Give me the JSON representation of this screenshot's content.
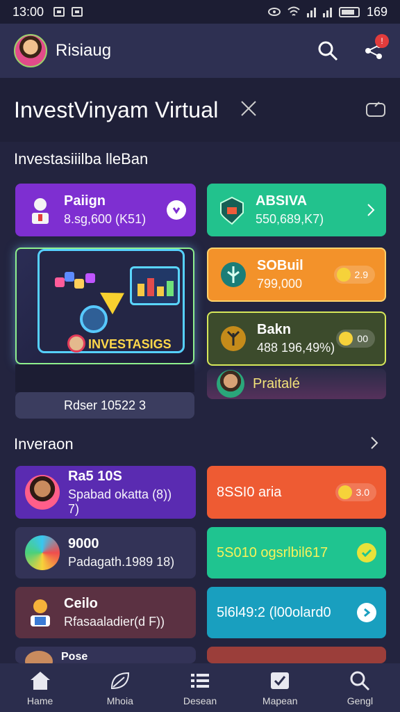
{
  "status_bar": {
    "time": "13:00",
    "battery": "169"
  },
  "header": {
    "app_name": "Risiaug",
    "notification_count": "!"
  },
  "title_bar": {
    "title": "InvestVinyam Virtual"
  },
  "section1": {
    "title": "Investasiiilba lleBan",
    "cards": [
      {
        "title": "Paiign",
        "subtitle": "8.sg,600 (K51)",
        "color": "#7e2fd1"
      },
      {
        "title": "ABSIVA",
        "subtitle": "550,689,K7)",
        "color": "#22c28d"
      },
      {
        "title": "SOBuil",
        "subtitle": "799,000",
        "pill": "2.9",
        "color": "#f3922a"
      },
      {
        "title": "Bakn",
        "subtitle": "488 196,49%)",
        "pill": "00",
        "color": "#3c4b2c"
      },
      {
        "title": "Praitalé",
        "color": "#55315b"
      }
    ],
    "promo": {
      "label": "INVESTASIGS",
      "footer": "Rdser 10522 3"
    }
  },
  "section2": {
    "title": "Inveraon",
    "left_cards": [
      {
        "title": "Ra5 10S",
        "subtitle": "Spabad okatta (8)) 7)",
        "color": "#5a2bb1"
      },
      {
        "title": "9000",
        "subtitle": "Padagath.1989 18)",
        "color": "#333357"
      },
      {
        "title": "Ceilo",
        "subtitle": "Rfasaaladier(d F))",
        "color": "#5b3142"
      },
      {
        "title": "Pose",
        "color": "#333357"
      }
    ],
    "right_cards": [
      {
        "title": "8SSI0 aria",
        "pill": "3.0",
        "color": "#ee5b33"
      },
      {
        "title": "5S010 ogsrlbil617",
        "color": "#1fc490"
      },
      {
        "title": "5l6l49:2 (l00olard0",
        "color": "#199fbf"
      },
      {
        "title": "",
        "color": "#9b3e3a"
      }
    ]
  },
  "bottom_nav": [
    {
      "label": "Hame",
      "icon": "home-icon"
    },
    {
      "label": "Mhoia",
      "icon": "leaf-icon"
    },
    {
      "label": "Desean",
      "icon": "list-icon"
    },
    {
      "label": "Mapean",
      "icon": "check-icon"
    },
    {
      "label": "Gengl",
      "icon": "search-icon"
    }
  ]
}
